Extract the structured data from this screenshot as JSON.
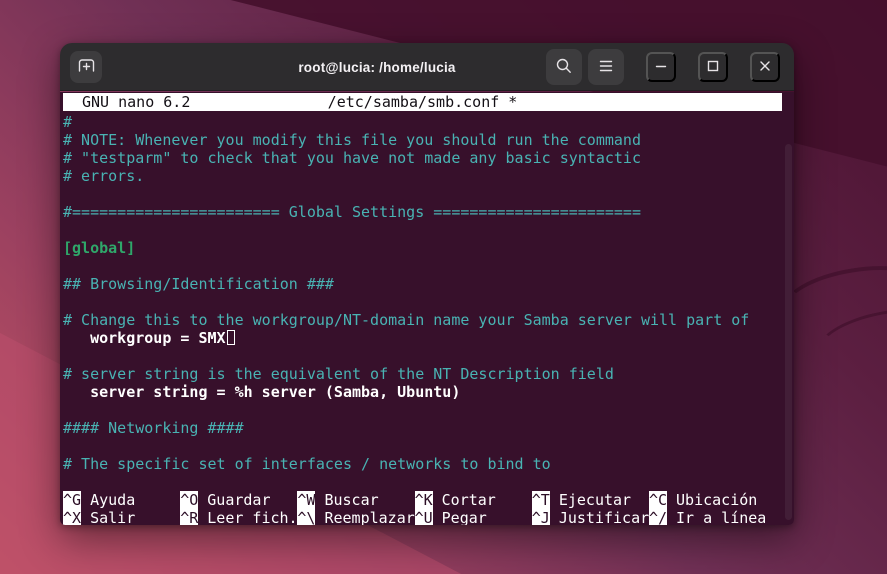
{
  "colors": {
    "terminal_bg": "#37102b",
    "comment_cyan": "#49b3b3",
    "section_green": "#2fa76a",
    "config_white": "#ffffff",
    "titlebar_bg": "#2d2c2e",
    "nano_bar_bg": "#ffffff",
    "desktop_dark_purple": "#4a1231",
    "desktop_pink": "#c25563"
  },
  "window": {
    "title": "root@lucia: /home/lucia",
    "controls": [
      "new-tab",
      "search",
      "menu",
      "minimize",
      "maximize",
      "close"
    ]
  },
  "nano": {
    "version": "GNU nano 6.2",
    "filename": "/etc/samba/smb.conf *",
    "lines": [
      {
        "t": "#",
        "role": "comment"
      },
      {
        "t": "# NOTE: Whenever you modify this file you should run the command",
        "role": "comment"
      },
      {
        "t": "# \"testparm\" to check that you have not made any basic syntactic",
        "role": "comment"
      },
      {
        "t": "# errors.",
        "role": "comment"
      },
      {
        "t": "",
        "role": "blank"
      },
      {
        "t": "#======================= Global Settings =======================",
        "role": "comment"
      },
      {
        "t": "",
        "role": "blank"
      },
      {
        "t": "[global]",
        "role": "section"
      },
      {
        "t": "",
        "role": "blank"
      },
      {
        "t": "## Browsing/Identification ###",
        "role": "comment"
      },
      {
        "t": "",
        "role": "blank"
      },
      {
        "t": "# Change this to the workgroup/NT-domain name your Samba server will part of",
        "role": "comment"
      },
      {
        "t": "   workgroup = SMX",
        "role": "config",
        "cursor": true
      },
      {
        "t": "",
        "role": "blank"
      },
      {
        "t": "# server string is the equivalent of the NT Description field",
        "role": "comment"
      },
      {
        "t": "   server string = %h server (Samba, Ubuntu)",
        "role": "config"
      },
      {
        "t": "",
        "role": "blank"
      },
      {
        "t": "#### Networking ####",
        "role": "comment"
      },
      {
        "t": "",
        "role": "blank"
      },
      {
        "t": "# The specific set of interfaces / networks to bind to",
        "role": "comment"
      },
      {
        "t": "",
        "role": "blank"
      }
    ],
    "shortcuts": [
      {
        "key": "^G",
        "label": "Ayuda"
      },
      {
        "key": "^X",
        "label": "Salir"
      },
      {
        "key": "^O",
        "label": "Guardar"
      },
      {
        "key": "^R",
        "label": "Leer fich."
      },
      {
        "key": "^W",
        "label": "Buscar"
      },
      {
        "key": "^\\",
        "label": "Reemplazar"
      },
      {
        "key": "^K",
        "label": "Cortar"
      },
      {
        "key": "^U",
        "label": "Pegar"
      },
      {
        "key": "^T",
        "label": "Ejecutar"
      },
      {
        "key": "^J",
        "label": "Justificar"
      },
      {
        "key": "^C",
        "label": "Ubicación"
      },
      {
        "key": "^/",
        "label": "Ir a línea"
      }
    ]
  }
}
